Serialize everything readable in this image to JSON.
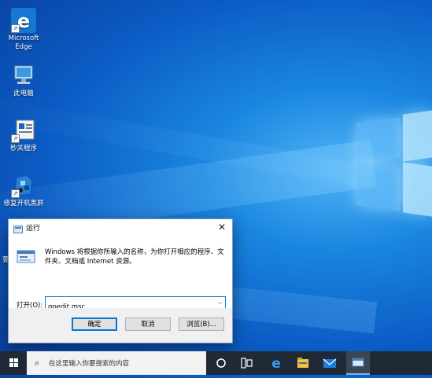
{
  "desktop": {
    "icons": [
      {
        "label_line1": "Microsoft",
        "label_line2": "Edge",
        "icon": "edge-icon"
      },
      {
        "label_line1": "此电脑",
        "label_line2": "",
        "icon": "computer-icon"
      },
      {
        "label_line1": "秒关程序",
        "label_line2": "",
        "icon": "program-icon"
      },
      {
        "label_line1": "修复开机黑屏",
        "label_line2": "",
        "icon": "repair-icon"
      }
    ]
  },
  "run_dialog": {
    "title": "运行",
    "close_label": "✕",
    "description": "Windows 将根据你所输入的名称，为你打开相应的程序、文件夹、文档或 Internet 资源。",
    "open_label": "打开(O):",
    "input_value": "gpedit.msc",
    "ok_label": "确定",
    "cancel_label": "取消",
    "browse_label": "浏览(B)..."
  },
  "taskbar": {
    "search_placeholder": "在这里输入你要搜索的内容",
    "items": [
      "task-view-icon",
      "edge-icon",
      "file-explorer-icon",
      "mail-icon",
      "run-icon"
    ]
  },
  "colors": {
    "accent": "#0078d7",
    "taskbar": "#1f2a36"
  }
}
